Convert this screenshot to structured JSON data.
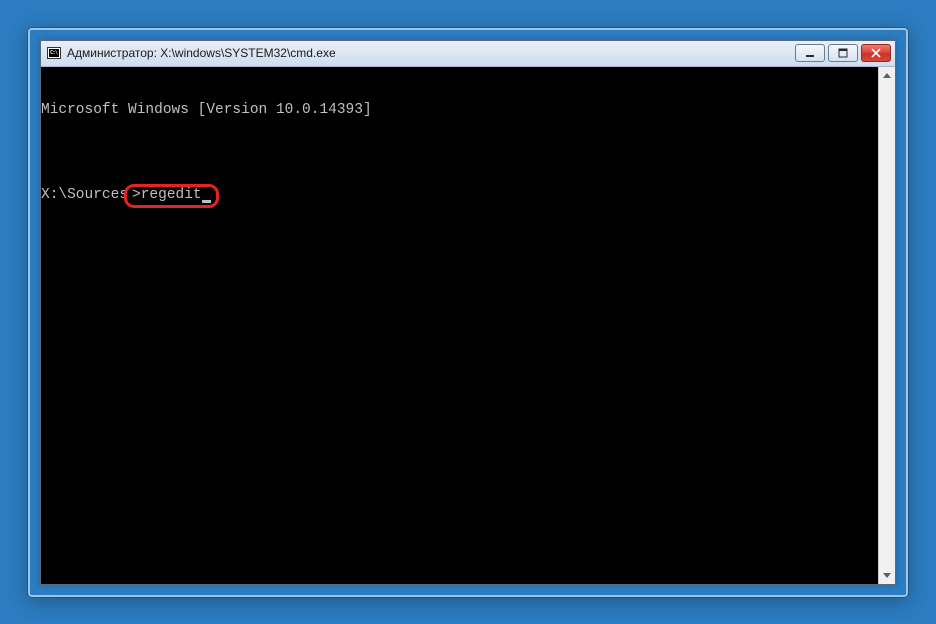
{
  "window": {
    "title": "Администратор: X:\\windows\\SYSTEM32\\cmd.exe"
  },
  "console": {
    "line1": "Microsoft Windows [Version 10.0.14393]",
    "blank": "",
    "prompt": "X:\\Sources",
    "prompt_sep": ">",
    "command": "regedit"
  }
}
